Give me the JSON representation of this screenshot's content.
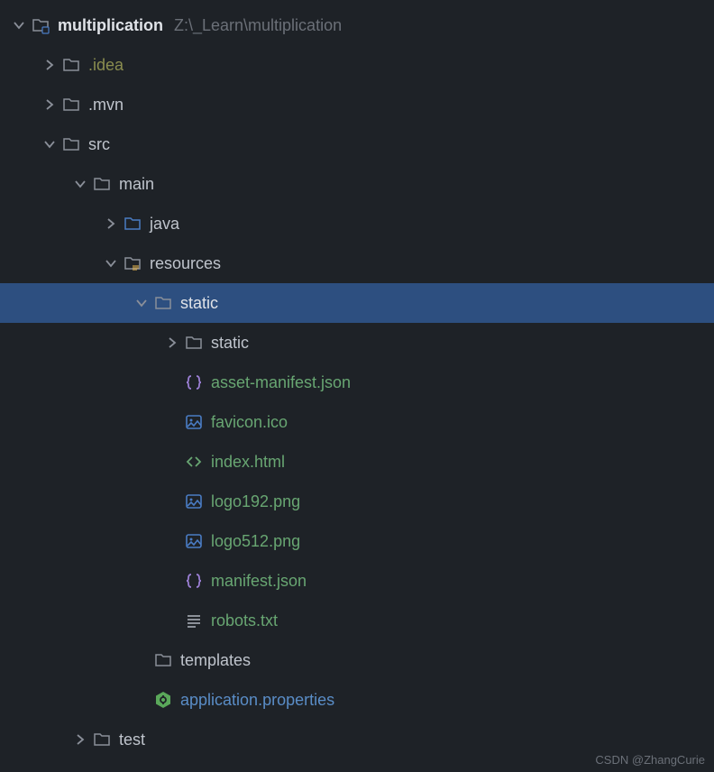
{
  "root": {
    "name": "multiplication",
    "path": "Z:\\_Learn\\multiplication"
  },
  "items": [
    {
      "label": ".idea"
    },
    {
      "label": ".mvn"
    },
    {
      "label": "src"
    },
    {
      "label": "main"
    },
    {
      "label": "java"
    },
    {
      "label": "resources"
    },
    {
      "label": "static"
    },
    {
      "label": "static"
    },
    {
      "label": "asset-manifest.json"
    },
    {
      "label": "favicon.ico"
    },
    {
      "label": "index.html"
    },
    {
      "label": "logo192.png"
    },
    {
      "label": "logo512.png"
    },
    {
      "label": "manifest.json"
    },
    {
      "label": "robots.txt"
    },
    {
      "label": "templates"
    },
    {
      "label": "application.properties"
    },
    {
      "label": "test"
    }
  ],
  "watermark": "CSDN @ZhangCurie"
}
